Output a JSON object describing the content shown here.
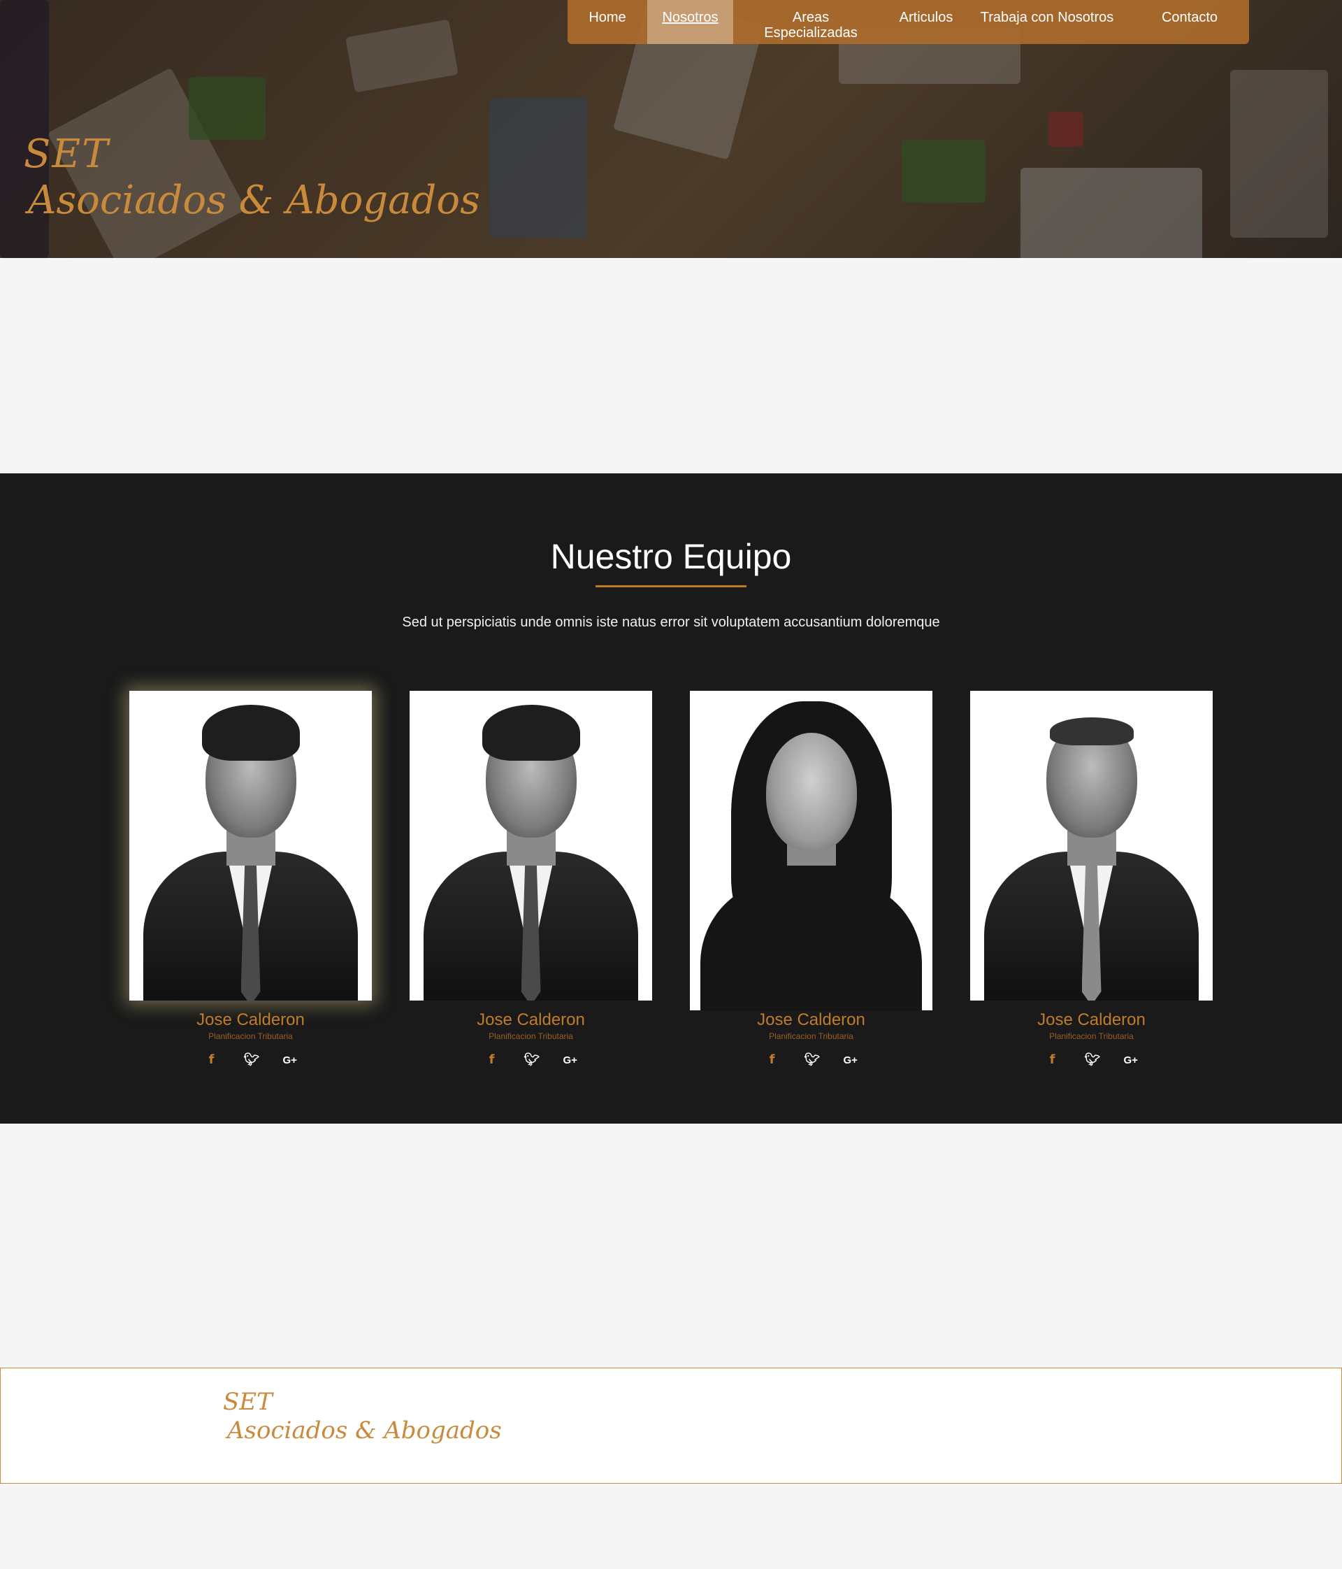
{
  "brand": {
    "line1": "SET",
    "line2": "Asociados & Abogados"
  },
  "nav": {
    "items": [
      {
        "label": "Home"
      },
      {
        "label": "Nosotros",
        "active": true
      },
      {
        "label": "Areas Especializadas"
      },
      {
        "label": "Articulos"
      },
      {
        "label": "Trabaja con Nosotros"
      },
      {
        "label": "Contacto"
      }
    ]
  },
  "team": {
    "title": "Nuestro Equipo",
    "lead": "Sed ut perspiciatis unde omnis iste natus error sit voluptatem accusantium doloremque",
    "members": [
      {
        "name": "Jose Calderon",
        "role": "Planificacion Tributaria"
      },
      {
        "name": "Jose Calderon",
        "role": "Planificacion Tributaria"
      },
      {
        "name": "Jose Calderon",
        "role": "Planificacion Tributaria"
      },
      {
        "name": "Jose Calderon",
        "role": "Planificacion Tributaria"
      }
    ],
    "social_icons": [
      "facebook-icon",
      "twitter-icon",
      "google-plus-icon"
    ],
    "social_glyphs": {
      "facebook": "f",
      "twitter": "🐦︎",
      "google_plus": "G+"
    }
  },
  "footer": {
    "line1": "SET",
    "line2": "Asociados & Abogados"
  },
  "colors": {
    "accent": "#c17b2b",
    "nav_bg": "#ab6b2c",
    "team_bg": "#191a19",
    "page_bg": "#f5f5f5"
  }
}
